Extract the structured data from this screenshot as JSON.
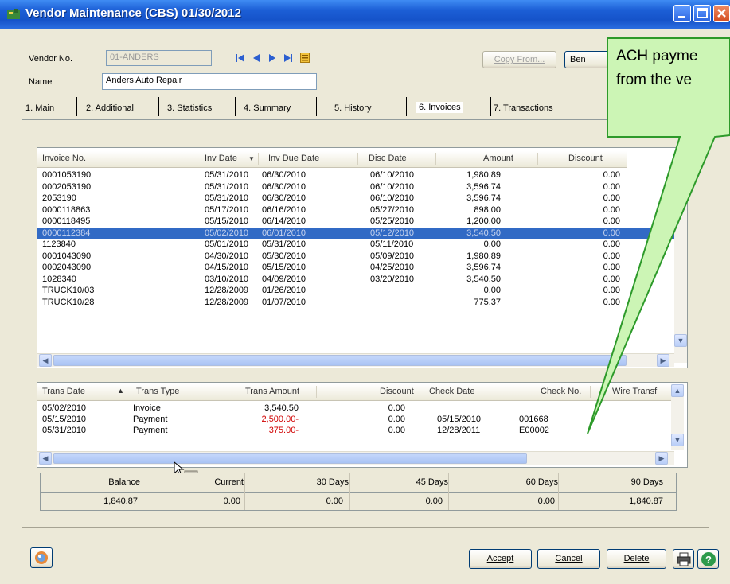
{
  "window": {
    "title": "Vendor Maintenance (CBS) 01/30/2012"
  },
  "header": {
    "vendor_no_label": "Vendor No.",
    "vendor_no_value": "01-ANDERS",
    "name_label": "Name",
    "name_value": "Anders Auto Repair",
    "copy_from_label": "Copy From...",
    "bene_label": "Ben"
  },
  "tabs": [
    "1. Main",
    "2. Additional",
    "3. Statistics",
    "4. Summary",
    "5. History",
    "6. Invoices",
    "7. Transactions"
  ],
  "invoices": {
    "columns": [
      "Invoice No.",
      "Inv Date",
      "Inv Due Date",
      "Disc Date",
      "Amount",
      "Discount"
    ],
    "rows": [
      [
        "0001053190",
        "05/31/2010",
        "06/30/2010",
        "06/10/2010",
        "1,980.89",
        "0.00"
      ],
      [
        "0002053190",
        "05/31/2010",
        "06/30/2010",
        "06/10/2010",
        "3,596.74",
        "0.00"
      ],
      [
        "2053190",
        "05/31/2010",
        "06/30/2010",
        "06/10/2010",
        "3,596.74",
        "0.00"
      ],
      [
        "0000118863",
        "05/17/2010",
        "06/16/2010",
        "05/27/2010",
        "898.00",
        "0.00"
      ],
      [
        "0000118495",
        "05/15/2010",
        "06/14/2010",
        "05/25/2010",
        "1,200.00",
        "0.00"
      ],
      [
        "0000112384",
        "05/02/2010",
        "06/01/2010",
        "05/12/2010",
        "3,540.50",
        "0.00"
      ],
      [
        "1123840",
        "05/01/2010",
        "05/31/2010",
        "05/11/2010",
        "0.00",
        "0.00"
      ],
      [
        "0001043090",
        "04/30/2010",
        "05/30/2010",
        "05/09/2010",
        "1,980.89",
        "0.00"
      ],
      [
        "0002043090",
        "04/15/2010",
        "05/15/2010",
        "04/25/2010",
        "3,596.74",
        "0.00"
      ],
      [
        "1028340",
        "03/10/2010",
        "04/09/2010",
        "03/20/2010",
        "3,540.50",
        "0.00"
      ],
      [
        "TRUCK10/03",
        "12/28/2009",
        "01/26/2010",
        "",
        "0.00",
        "0.00"
      ],
      [
        "TRUCK10/28",
        "12/28/2009",
        "01/07/2010",
        "",
        "775.37",
        "0.00"
      ]
    ],
    "selected_index": 5
  },
  "transactions": {
    "columns": [
      "Trans Date",
      "Trans Type",
      "Trans Amount",
      "Discount",
      "Check Date",
      "Check No.",
      "Wire Transf"
    ],
    "rows": [
      [
        "05/02/2010",
        "Invoice",
        "3,540.50",
        "0.00",
        "",
        ""
      ],
      [
        "05/15/2010",
        "Payment",
        "2,500.00-",
        "0.00",
        "05/15/2010",
        "001668"
      ],
      [
        "05/31/2010",
        "Payment",
        "375.00-",
        "0.00",
        "12/28/2011",
        "E00002"
      ]
    ]
  },
  "aging": {
    "labels": [
      "Balance",
      "Current",
      "30 Days",
      "45 Days",
      "60 Days",
      "90 Days"
    ],
    "values": [
      "1,840.87",
      "0.00",
      "0.00",
      "0.00",
      "0.00",
      "1,840.87"
    ]
  },
  "buttons": {
    "accept": "Accept",
    "cancel": "Cancel",
    "delete": "Delete"
  },
  "callout": {
    "line1": "ACH payme",
    "line2": "from the ve"
  },
  "colors": {
    "accent": "#316ac5",
    "callout_fill": "#ccf5b5",
    "callout_border": "#2d9a2a",
    "negative": "#d00000"
  }
}
